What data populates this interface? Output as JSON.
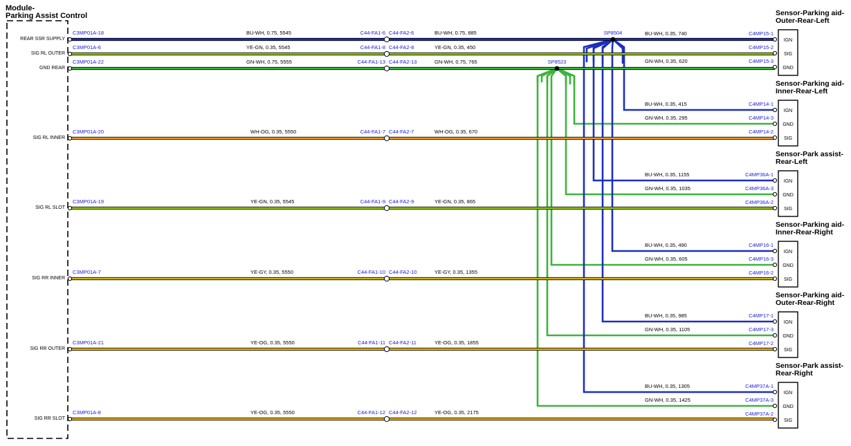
{
  "module": {
    "title_line1": "Module-",
    "title_line2": "Parking Assist Control",
    "pins": [
      "REAR SSR SUPPLY",
      "SIG RL OUTER",
      "GND REAR",
      "SIG RL INNER",
      "SIG RL SLOT",
      "SIG RR INNER",
      "SIG RR OUTER",
      "SIG RR SLOT"
    ]
  },
  "colors": {
    "BU-WH": "#1c2fc0",
    "YE-GN": "#9acd1a",
    "GN-WH": "#3cb43c",
    "WH-OG": "#f0a030",
    "YE-GY": "#d8b800",
    "YE-OG": "#f2b400",
    "connector_text": "#1a1ad6"
  },
  "splices": [
    "SP8504",
    "SP8523"
  ],
  "main_wires": [
    {
      "pin": "REAR SSR SUPPLY",
      "conn_module": "C3MP01A-18",
      "spec1": "BU-WH,  0.75,  5545",
      "fa1": "C44-FA1-6",
      "fa2": "C44-FA2-6",
      "spec2": "BU-WH,  0.75,  885",
      "color": "BU-WH"
    },
    {
      "pin": "SIG RL OUTER",
      "conn_module": "C3MP01A-6",
      "spec1": "YE-GN,  0.35,  5545",
      "fa1": "C44-FA1-8",
      "fa2": "C44-FA2-8",
      "spec2": "YE-GN,  0.35,  450",
      "color": "YE-GN"
    },
    {
      "pin": "GND REAR",
      "conn_module": "C3MP01A-22",
      "spec1": "GN-WH,  0.75,  5555",
      "fa1": "C44-FA1-13",
      "fa2": "C44-FA2-13",
      "spec2": "GN-WH,  0.75,  765",
      "color": "GN-WH"
    },
    {
      "pin": "SIG RL INNER",
      "conn_module": "C3MP01A-20",
      "spec1": "WH-OG,  0.35,  5550",
      "fa1": "C44-FA1-7",
      "fa2": "C44-FA2-7",
      "spec2": "WH-OG,  0.35,  670",
      "color": "WH-OG"
    },
    {
      "pin": "SIG RL SLOT",
      "conn_module": "C3MP01A-19",
      "spec1": "YE-GN,  0.35,  5545",
      "fa1": "C44-FA1-9",
      "fa2": "C44-FA2-9",
      "spec2": "YE-GN,  0.35,  865",
      "color": "YE-GN"
    },
    {
      "pin": "SIG RR INNER",
      "conn_module": "C3MP01A-7",
      "spec1": "YE-GY,  0.35,  5550",
      "fa1": "C44-FA1-10",
      "fa2": "C44-FA2-10",
      "spec2": "YE-GY,  0.35,  1355",
      "color": "YE-GY"
    },
    {
      "pin": "SIG RR OUTER",
      "conn_module": "C3MP01A-21",
      "spec1": "YE-OG,  0.35,  5550",
      "fa1": "C44-FA1-11",
      "fa2": "C44-FA2-11",
      "spec2": "YE-OG,  0.35,  1855",
      "color": "YE-OG"
    },
    {
      "pin": "SIG RR SLOT",
      "conn_module": "C3MP01A-8",
      "spec1": "YE-OG,  0.35,  5550",
      "fa1": "C44-FA1-12",
      "fa2": "C44-FA2-12",
      "spec2": "YE-OG,  0.35,  2175",
      "color": "YE-OG"
    }
  ],
  "sensors": [
    {
      "title_line1": "Sensor-Parking aid-",
      "title_line2": "Outer-Rear-Left",
      "pins": [
        "IGN",
        "SIG",
        "GND"
      ],
      "wires": [
        {
          "spec": "BU-WH,  0.35,  740",
          "conn": "C4MP15-1"
        },
        {
          "spec": "",
          "conn": "C4MP15-2"
        },
        {
          "spec": "GN-WH,  0.35,  620",
          "conn": "C4MP15-3"
        }
      ]
    },
    {
      "title_line1": "Sensor-Parking aid-",
      "title_line2": "Inner-Rear-Left",
      "pins": [
        "IGN",
        "GND",
        "SIG"
      ],
      "wires": [
        {
          "spec": "BU-WH,  0.35,  415",
          "conn": "C4MP14-1"
        },
        {
          "spec": "GN-WH,  0.35,  295",
          "conn": "C4MP14-3"
        },
        {
          "spec": "",
          "conn": "C4MP14-2"
        }
      ]
    },
    {
      "title_line1": "Sensor-Park assist-",
      "title_line2": "Rear-Left",
      "pins": [
        "IGN",
        "GND",
        "SIG"
      ],
      "wires": [
        {
          "spec": "BU-WH,  0.35,  1155",
          "conn": "C4MP36A-1"
        },
        {
          "spec": "GN-WH,  0.35,  1035",
          "conn": "C4MP36A-3"
        },
        {
          "spec": "",
          "conn": "C4MP36A-2"
        }
      ]
    },
    {
      "title_line1": "Sensor-Parking aid-",
      "title_line2": "Inner-Rear-Right",
      "pins": [
        "IGN",
        "GND",
        "SIG"
      ],
      "wires": [
        {
          "spec": "BU-WH,  0.35,  490",
          "conn": "C4MP16-1"
        },
        {
          "spec": "GN-WH,  0.35,  605",
          "conn": "C4MP16-3"
        },
        {
          "spec": "",
          "conn": "C4MP16-2"
        }
      ]
    },
    {
      "title_line1": "Sensor-Parking aid-",
      "title_line2": "Outer-Rear-Right",
      "pins": [
        "IGN",
        "GND",
        "SIG"
      ],
      "wires": [
        {
          "spec": "BU-WH,  0.35,  985",
          "conn": "C4MP17-1"
        },
        {
          "spec": "GN-WH,  0.35,  1105",
          "conn": "C4MP17-3"
        },
        {
          "spec": "",
          "conn": "C4MP17-2"
        }
      ]
    },
    {
      "title_line1": "Sensor-Park assist-",
      "title_line2": "Rear-Right",
      "pins": [
        "IGN",
        "GND",
        "SIG"
      ],
      "wires": [
        {
          "spec": "BU-WH,  0.35,  1305",
          "conn": "C4MP37A-1"
        },
        {
          "spec": "GN-WH,  0.35,  1425",
          "conn": "C4MP37A-3"
        },
        {
          "spec": "",
          "conn": "C4MP37A-2"
        }
      ]
    }
  ]
}
